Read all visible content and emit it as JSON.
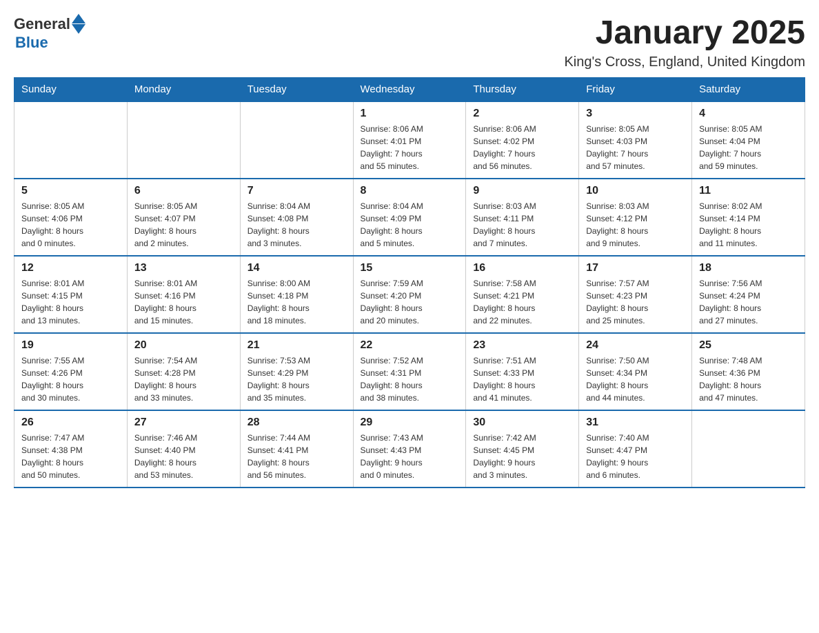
{
  "header": {
    "logo": {
      "general": "General",
      "blue": "Blue"
    },
    "title": "January 2025",
    "location": "King's Cross, England, United Kingdom"
  },
  "days_of_week": [
    "Sunday",
    "Monday",
    "Tuesday",
    "Wednesday",
    "Thursday",
    "Friday",
    "Saturday"
  ],
  "weeks": [
    {
      "cells": [
        {
          "day": "",
          "info": ""
        },
        {
          "day": "",
          "info": ""
        },
        {
          "day": "",
          "info": ""
        },
        {
          "day": "1",
          "info": "Sunrise: 8:06 AM\nSunset: 4:01 PM\nDaylight: 7 hours\nand 55 minutes."
        },
        {
          "day": "2",
          "info": "Sunrise: 8:06 AM\nSunset: 4:02 PM\nDaylight: 7 hours\nand 56 minutes."
        },
        {
          "day": "3",
          "info": "Sunrise: 8:05 AM\nSunset: 4:03 PM\nDaylight: 7 hours\nand 57 minutes."
        },
        {
          "day": "4",
          "info": "Sunrise: 8:05 AM\nSunset: 4:04 PM\nDaylight: 7 hours\nand 59 minutes."
        }
      ]
    },
    {
      "cells": [
        {
          "day": "5",
          "info": "Sunrise: 8:05 AM\nSunset: 4:06 PM\nDaylight: 8 hours\nand 0 minutes."
        },
        {
          "day": "6",
          "info": "Sunrise: 8:05 AM\nSunset: 4:07 PM\nDaylight: 8 hours\nand 2 minutes."
        },
        {
          "day": "7",
          "info": "Sunrise: 8:04 AM\nSunset: 4:08 PM\nDaylight: 8 hours\nand 3 minutes."
        },
        {
          "day": "8",
          "info": "Sunrise: 8:04 AM\nSunset: 4:09 PM\nDaylight: 8 hours\nand 5 minutes."
        },
        {
          "day": "9",
          "info": "Sunrise: 8:03 AM\nSunset: 4:11 PM\nDaylight: 8 hours\nand 7 minutes."
        },
        {
          "day": "10",
          "info": "Sunrise: 8:03 AM\nSunset: 4:12 PM\nDaylight: 8 hours\nand 9 minutes."
        },
        {
          "day": "11",
          "info": "Sunrise: 8:02 AM\nSunset: 4:14 PM\nDaylight: 8 hours\nand 11 minutes."
        }
      ]
    },
    {
      "cells": [
        {
          "day": "12",
          "info": "Sunrise: 8:01 AM\nSunset: 4:15 PM\nDaylight: 8 hours\nand 13 minutes."
        },
        {
          "day": "13",
          "info": "Sunrise: 8:01 AM\nSunset: 4:16 PM\nDaylight: 8 hours\nand 15 minutes."
        },
        {
          "day": "14",
          "info": "Sunrise: 8:00 AM\nSunset: 4:18 PM\nDaylight: 8 hours\nand 18 minutes."
        },
        {
          "day": "15",
          "info": "Sunrise: 7:59 AM\nSunset: 4:20 PM\nDaylight: 8 hours\nand 20 minutes."
        },
        {
          "day": "16",
          "info": "Sunrise: 7:58 AM\nSunset: 4:21 PM\nDaylight: 8 hours\nand 22 minutes."
        },
        {
          "day": "17",
          "info": "Sunrise: 7:57 AM\nSunset: 4:23 PM\nDaylight: 8 hours\nand 25 minutes."
        },
        {
          "day": "18",
          "info": "Sunrise: 7:56 AM\nSunset: 4:24 PM\nDaylight: 8 hours\nand 27 minutes."
        }
      ]
    },
    {
      "cells": [
        {
          "day": "19",
          "info": "Sunrise: 7:55 AM\nSunset: 4:26 PM\nDaylight: 8 hours\nand 30 minutes."
        },
        {
          "day": "20",
          "info": "Sunrise: 7:54 AM\nSunset: 4:28 PM\nDaylight: 8 hours\nand 33 minutes."
        },
        {
          "day": "21",
          "info": "Sunrise: 7:53 AM\nSunset: 4:29 PM\nDaylight: 8 hours\nand 35 minutes."
        },
        {
          "day": "22",
          "info": "Sunrise: 7:52 AM\nSunset: 4:31 PM\nDaylight: 8 hours\nand 38 minutes."
        },
        {
          "day": "23",
          "info": "Sunrise: 7:51 AM\nSunset: 4:33 PM\nDaylight: 8 hours\nand 41 minutes."
        },
        {
          "day": "24",
          "info": "Sunrise: 7:50 AM\nSunset: 4:34 PM\nDaylight: 8 hours\nand 44 minutes."
        },
        {
          "day": "25",
          "info": "Sunrise: 7:48 AM\nSunset: 4:36 PM\nDaylight: 8 hours\nand 47 minutes."
        }
      ]
    },
    {
      "cells": [
        {
          "day": "26",
          "info": "Sunrise: 7:47 AM\nSunset: 4:38 PM\nDaylight: 8 hours\nand 50 minutes."
        },
        {
          "day": "27",
          "info": "Sunrise: 7:46 AM\nSunset: 4:40 PM\nDaylight: 8 hours\nand 53 minutes."
        },
        {
          "day": "28",
          "info": "Sunrise: 7:44 AM\nSunset: 4:41 PM\nDaylight: 8 hours\nand 56 minutes."
        },
        {
          "day": "29",
          "info": "Sunrise: 7:43 AM\nSunset: 4:43 PM\nDaylight: 9 hours\nand 0 minutes."
        },
        {
          "day": "30",
          "info": "Sunrise: 7:42 AM\nSunset: 4:45 PM\nDaylight: 9 hours\nand 3 minutes."
        },
        {
          "day": "31",
          "info": "Sunrise: 7:40 AM\nSunset: 4:47 PM\nDaylight: 9 hours\nand 6 minutes."
        },
        {
          "day": "",
          "info": ""
        }
      ]
    }
  ]
}
